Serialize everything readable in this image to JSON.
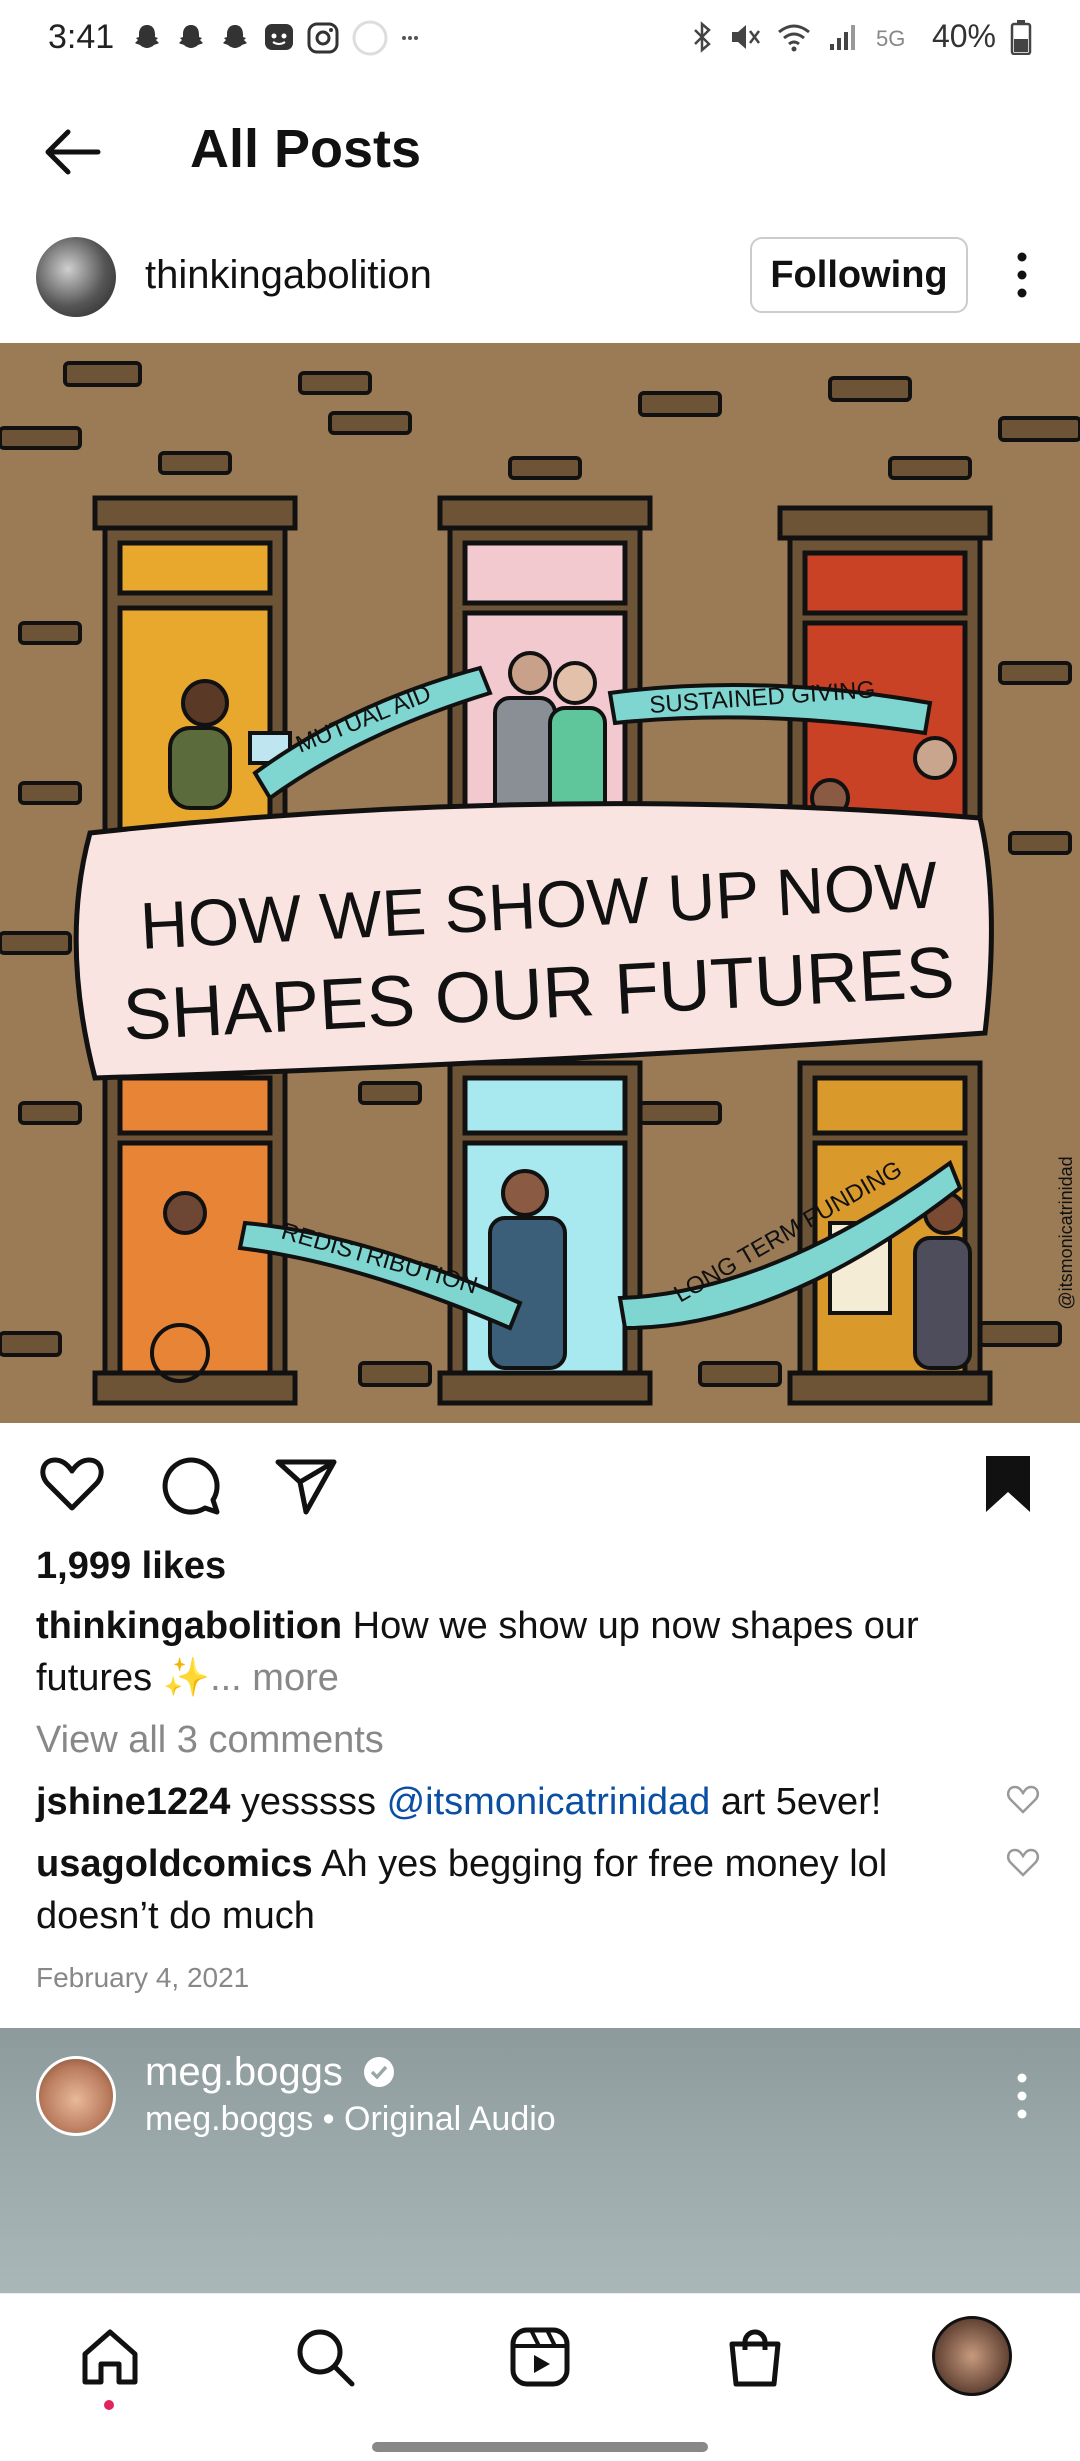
{
  "status_bar": {
    "time": "3:41",
    "battery": "40%"
  },
  "header": {
    "title": "All Posts"
  },
  "post": {
    "username": "thinkingabolition",
    "follow_label": "Following",
    "image_text": {
      "line1": "HOW WE SHOW UP NOW",
      "line2": "SHAPES OUR FUTURES",
      "banner1": "MUTUAL AID",
      "banner2": "SUSTAINED GIVING",
      "banner3": "REDISTRIBUTION",
      "banner4": "LONG TERM FUNDING",
      "signature": "@itsmonicatrinidad"
    },
    "likes": "1,999 likes",
    "caption_user": "thinkingabolition",
    "caption_text": "How we show up now shapes our futures",
    "caption_emoji": "✨",
    "caption_more": "... more",
    "view_comments": "View all 3 comments",
    "comments": [
      {
        "user": "jshine1224",
        "text_pre": "yesssss",
        "mention": "@itsmonicatrinidad",
        "text_post": "art 5ever!"
      },
      {
        "user": "usagoldcomics",
        "text": "Ah yes begging for free money lol doesn’t do much"
      }
    ],
    "date": "February 4, 2021"
  },
  "reel": {
    "username": "meg.boggs",
    "subtitle": "meg.boggs • Original Audio"
  },
  "icons": {
    "back": "arrow-left-icon",
    "more": "more-vertical-icon",
    "like": "heart-icon",
    "comment": "comment-icon",
    "share": "send-icon",
    "save": "bookmark-icon",
    "home": "home-icon",
    "search": "search-icon",
    "reels": "reels-icon",
    "shop": "shop-icon"
  },
  "colors": {
    "mention": "#0b4fa3",
    "banner": "#7fd6d0",
    "brick": "#9a7b55"
  }
}
